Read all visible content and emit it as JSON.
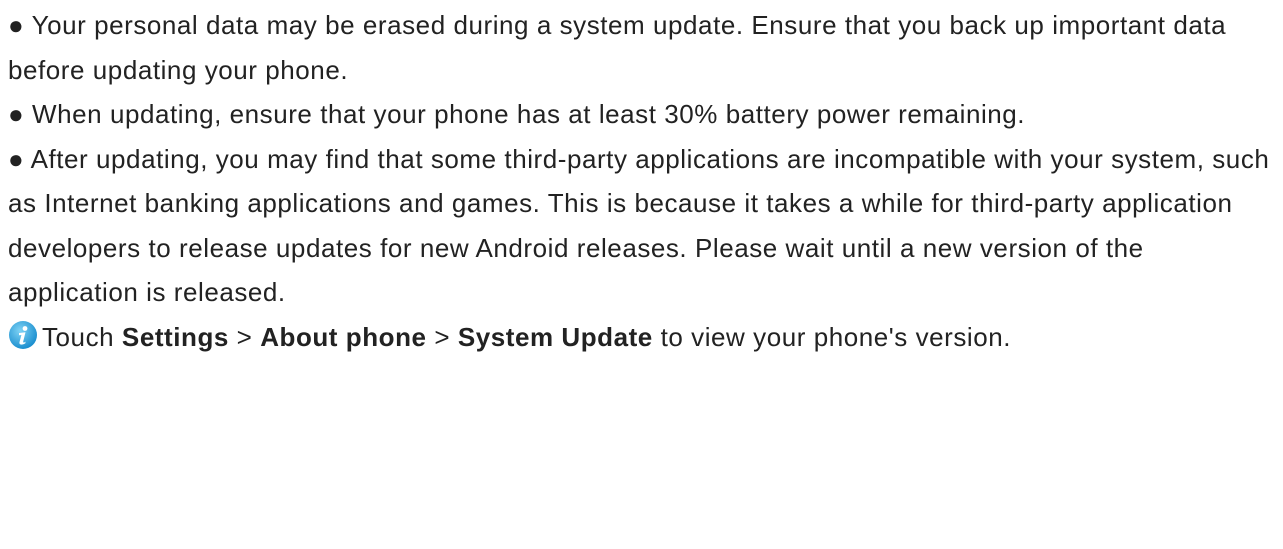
{
  "bullets": [
    {
      "marker": "●",
      "text": "Your personal data may be erased during a system update. Ensure that you back up important data before updating your phone."
    },
    {
      "marker": "●",
      "text": "When updating, ensure that your phone has at least 30% battery power remaining."
    },
    {
      "marker": "●",
      "text": "After updating, you may find that some third-party applications are incompatible with your system, such as Internet banking applications and games. This is because it takes a while for third-party application developers to release updates for new Android releases. Please wait until a new version of the application is released."
    }
  ],
  "note": {
    "icon": "info-icon",
    "icon_color": "#2aa7df",
    "prefix": "Touch",
    "path": [
      "Settings",
      "About phone",
      "System Update"
    ],
    "separator": ">",
    "suffix": "to view your phone's version."
  }
}
